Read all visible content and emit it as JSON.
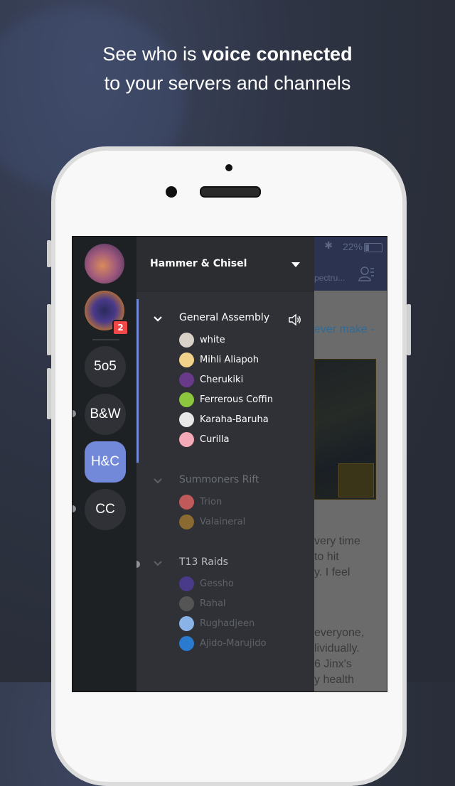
{
  "headline": {
    "prefix": "See who is ",
    "bold": "voice connected",
    "line2": "to your servers and channels"
  },
  "status_bar": {
    "bluetooth_icon": "bluetooth-icon",
    "battery_percent": "22%",
    "battery_icon": "battery-icon"
  },
  "chat_background": {
    "channel_truncated": "pectru...",
    "members_icon": "members-icon",
    "link_fragment": "ever make -",
    "text_lines_1": [
      "very time",
      "to hit",
      "y. I feel"
    ],
    "text_lines_2": [
      "everyone,",
      "lividually.",
      "6 Jinx's",
      "y health"
    ]
  },
  "servers": [
    {
      "type": "avatar",
      "name": "server-avatar-1",
      "colors": [
        "#8a5a9c",
        "#d98b5a"
      ]
    },
    {
      "type": "avatar",
      "name": "server-avatar-2",
      "colors": [
        "#3b3a7a",
        "#d4801e"
      ],
      "badge": "2"
    },
    {
      "type": "text",
      "label": "5o5"
    },
    {
      "type": "text",
      "label": "B&W",
      "unread": true
    },
    {
      "type": "text",
      "label": "H&C",
      "active": true
    },
    {
      "type": "text",
      "label": "CC",
      "unread": true
    }
  ],
  "panel": {
    "server_name": "Hammer & Chisel",
    "dropdown_icon": "caret-down-icon",
    "channels": [
      {
        "name": "General Assembly",
        "state": "connected",
        "users": [
          {
            "name": "white",
            "color": "#d8d2c8"
          },
          {
            "name": "Mihli Aliapoh",
            "color": "#f0d28a"
          },
          {
            "name": "Cherukiki",
            "color": "#6a3a8a"
          },
          {
            "name": "Ferrerous Coffin",
            "color": "#8cc63f"
          },
          {
            "name": "Karaha-Baruha",
            "color": "#e8e8e8"
          },
          {
            "name": "Curilla",
            "color": "#f4a9b8"
          }
        ]
      },
      {
        "name": "Summoners Rift",
        "state": "muted",
        "users": [
          {
            "name": "Trion",
            "color": "#c05a5a"
          },
          {
            "name": "Valaineral",
            "color": "#8a6a30"
          }
        ]
      },
      {
        "name": "T13 Raids",
        "state": "unread",
        "users": [
          {
            "name": "Gessho",
            "color": "#4a3a8a"
          },
          {
            "name": "Rahal",
            "color": "#555"
          },
          {
            "name": "Rughadjeen",
            "color": "#8ab4e8"
          },
          {
            "name": "Ajido-Marujido",
            "color": "#2a7ad0"
          }
        ]
      }
    ]
  },
  "colors": {
    "accent": "#7289da",
    "badge": "#f04747",
    "rail_bg": "#1e2124",
    "panel_bg": "#2f3136"
  }
}
